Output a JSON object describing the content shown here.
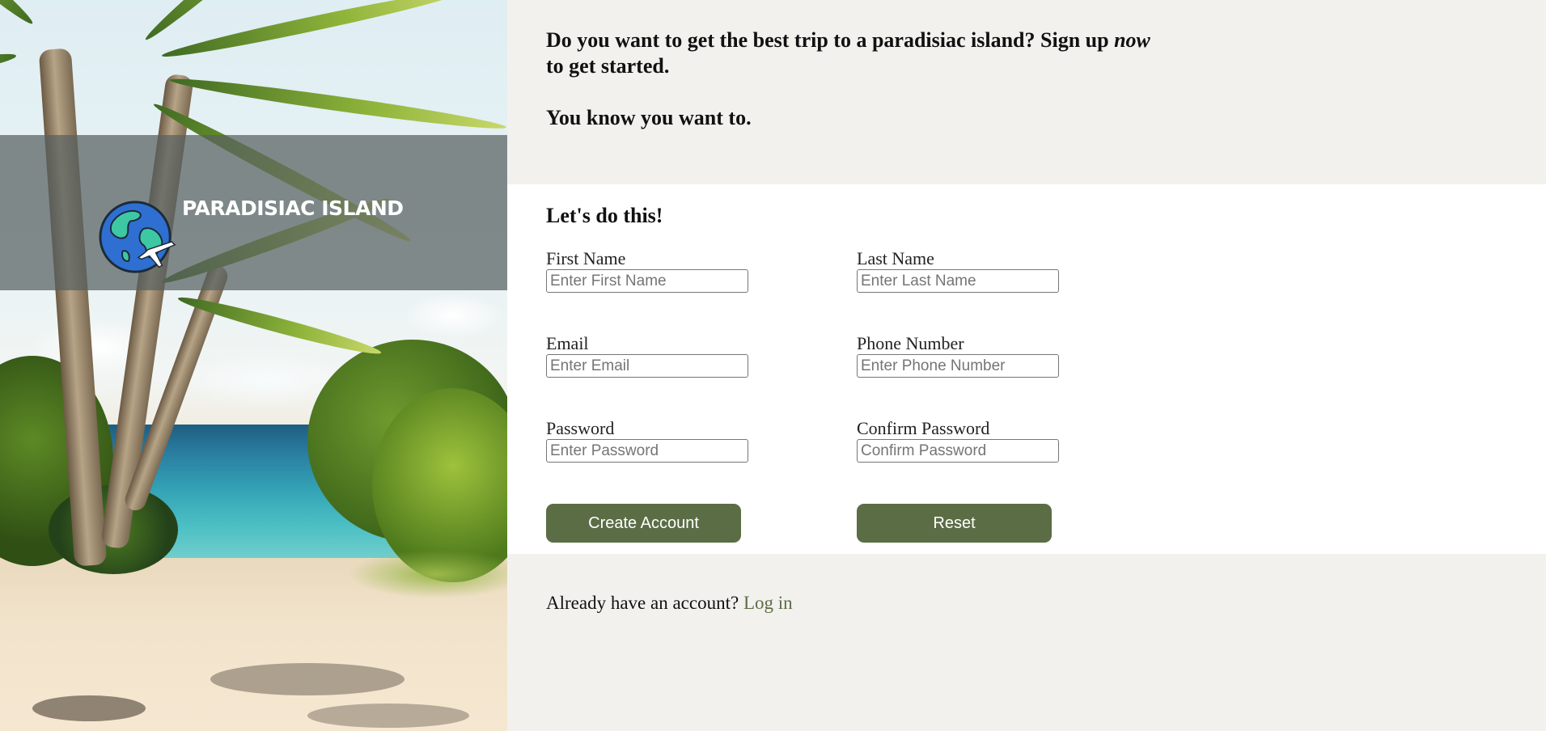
{
  "brand": {
    "name": "PARADISIAC ISLAND",
    "logo_icon": "globe-airplane-icon"
  },
  "intro": {
    "line1_before": "Do you want to get the best trip to a paradisiac island? Sign up ",
    "line1_emphasis": "now",
    "line1_after": " to get started.",
    "line2": "You know you want to."
  },
  "form": {
    "title": "Let's do this!",
    "fields": {
      "first_name": {
        "label": "First Name",
        "placeholder": "Enter First Name"
      },
      "last_name": {
        "label": "Last Name",
        "placeholder": "Enter Last Name"
      },
      "email": {
        "label": "Email",
        "placeholder": "Enter Email"
      },
      "phone": {
        "label": "Phone Number",
        "placeholder": "Enter Phone Number"
      },
      "password": {
        "label": "Password",
        "placeholder": "Enter Password"
      },
      "confirm_password": {
        "label": "Confirm Password",
        "placeholder": "Confirm Password"
      }
    },
    "buttons": {
      "create": "Create Account",
      "reset": "Reset"
    }
  },
  "login": {
    "prompt": "Already have an account?",
    "link": "Log in"
  },
  "colors": {
    "accent": "#5b6d45",
    "page_bg": "#f2f1ee",
    "panel_bg": "#ffffff"
  }
}
